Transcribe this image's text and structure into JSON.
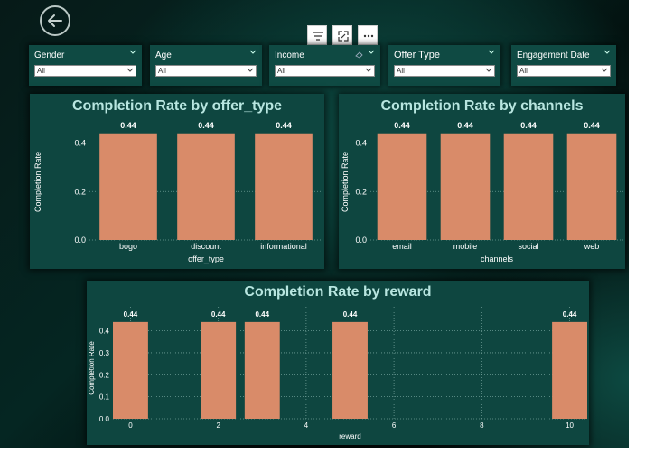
{
  "toolbar": {
    "back_icon": "arrow-left-icon",
    "filter_icon": "filter-icon",
    "focus_icon": "focus-mode-icon",
    "more_icon": "more-options-icon"
  },
  "slicers": [
    {
      "label": "Gender",
      "value": "All"
    },
    {
      "label": "Age",
      "value": "All"
    },
    {
      "label": "Income",
      "value": "All"
    },
    {
      "label": "Offer Type",
      "value": "All"
    },
    {
      "label": "Engagement Date",
      "value": "All"
    }
  ],
  "colors": {
    "bar": "#d98b69",
    "card": "#0e4640",
    "title": "#b8e6e0",
    "text": "#ffffff"
  },
  "chart_data": [
    {
      "type": "bar",
      "title": "Completion Rate by offer_type",
      "xlabel": "offer_type",
      "ylabel": "Completion Rate",
      "categories": [
        "bogo",
        "discount",
        "informational"
      ],
      "values": [
        0.44,
        0.44,
        0.44
      ],
      "data_labels": [
        "0.44",
        "0.44",
        "0.44"
      ],
      "y_ticks": [
        "0.0",
        "0.2",
        "0.4"
      ],
      "ylim": [
        0,
        0.48
      ],
      "grid": true
    },
    {
      "type": "bar",
      "title": "Completion Rate by channels",
      "xlabel": "channels",
      "ylabel": "Completion Rate",
      "categories": [
        "email",
        "mobile",
        "social",
        "web"
      ],
      "values": [
        0.44,
        0.44,
        0.44,
        0.44
      ],
      "data_labels": [
        "0.44",
        "0.44",
        "0.44",
        "0.44"
      ],
      "y_ticks": [
        "0.0",
        "0.2",
        "0.4"
      ],
      "ylim": [
        0,
        0.48
      ],
      "grid": true
    },
    {
      "type": "bar",
      "title": "Completion Rate by reward",
      "xlabel": "reward",
      "ylabel": "Completion Rate",
      "x": [
        0,
        2,
        3,
        5,
        10
      ],
      "values": [
        0.44,
        0.44,
        0.44,
        0.44,
        0.44
      ],
      "data_labels": [
        "0.44",
        "0.44",
        "0.44",
        "0.44",
        "0.44"
      ],
      "x_ticks": [
        "0",
        "2",
        "4",
        "6",
        "8",
        "10"
      ],
      "y_ticks": [
        "0.0",
        "0.1",
        "0.2",
        "0.3",
        "0.4"
      ],
      "xlim": [
        -0.4,
        10.4
      ],
      "ylim": [
        0,
        0.46
      ],
      "grid": true
    }
  ]
}
